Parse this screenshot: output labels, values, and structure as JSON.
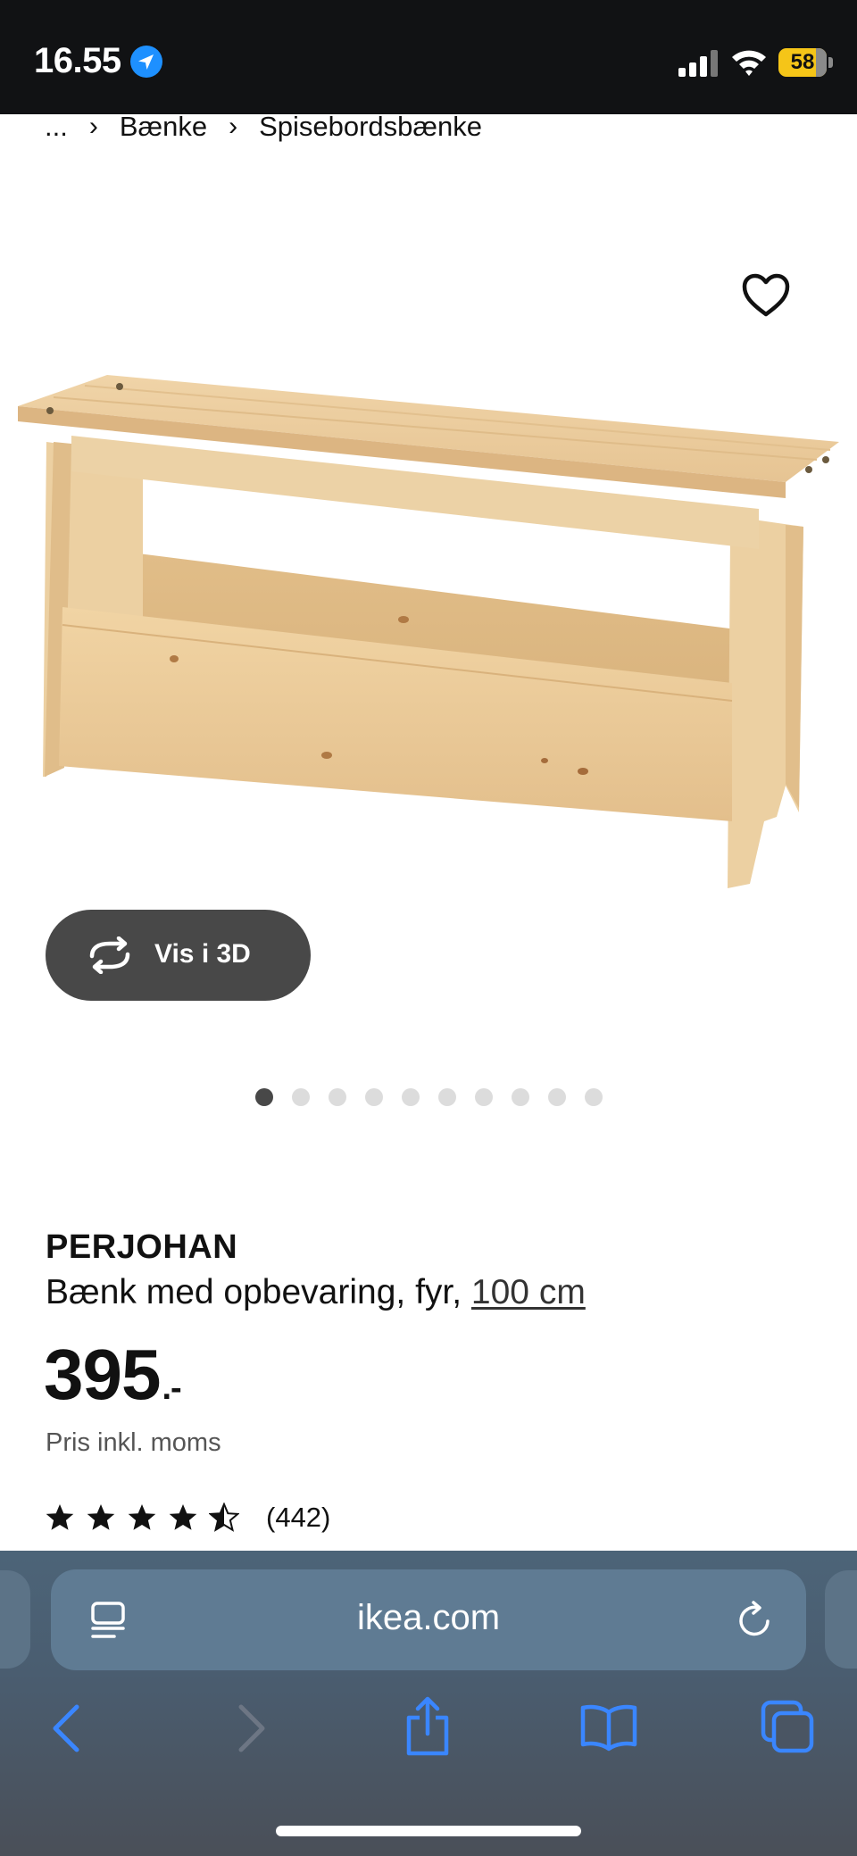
{
  "status_bar": {
    "time": "16.55",
    "battery": "58",
    "icons": [
      "location-arrow-icon",
      "signal-icon",
      "wifi-icon",
      "battery-icon"
    ]
  },
  "breadcrumb": {
    "items": [
      "...",
      "Bænke",
      "Spisebordsbænke"
    ],
    "separator": "›"
  },
  "product": {
    "image_alt": "PERJOHAN bench in pine",
    "view3d_label": "Vis i 3D",
    "carousel": {
      "total": 10,
      "active": 1
    },
    "name": "PERJOHAN",
    "description": "Bænk med opbevaring, fyr, ",
    "size_link": "100 cm",
    "price": "395",
    "price_suffix": ".-",
    "price_note": "Pris inkl. moms",
    "rating": {
      "value": 4.5,
      "max": 5,
      "count": "(442)"
    }
  },
  "browser": {
    "url": "ikea.com",
    "icons": [
      "reader-icon",
      "reload-icon",
      "back-icon",
      "forward-icon",
      "share-icon",
      "bookmarks-icon",
      "tabs-icon"
    ]
  },
  "colors": {
    "status_bar": "#111214",
    "view3d_bg": "#484848",
    "dot_active": "#484848",
    "dot_inactive": "#dcdcdc",
    "browser_bar": "#4a5d70",
    "ios_blue": "#3a86ff",
    "battery": "#f5c518"
  }
}
